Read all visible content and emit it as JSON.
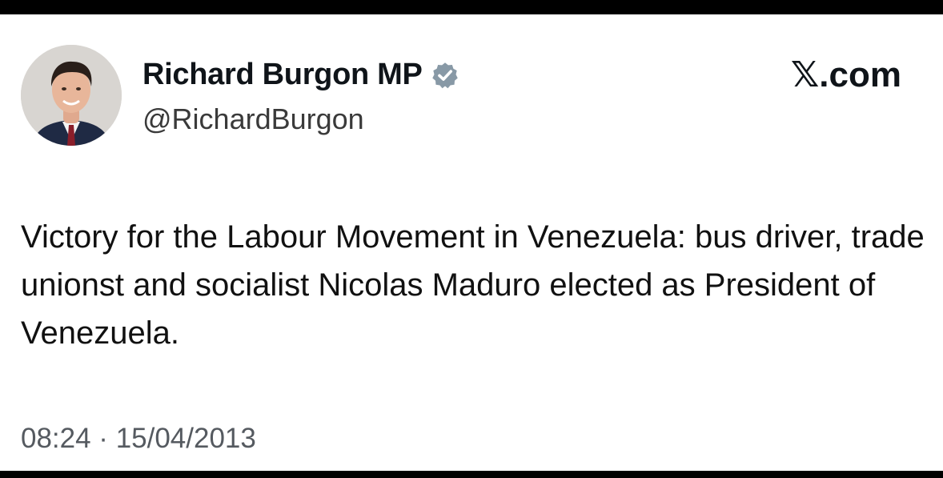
{
  "author": {
    "display_name": "Richard Burgon MP",
    "handle": "@RichardBurgon",
    "verified_icon": "verified-badge-icon",
    "verified_color": "#8899a6"
  },
  "brand": {
    "label": "𝕏.com"
  },
  "tweet": {
    "text": "Victory for the Labour Movement in Venezuela: bus driver, trade unionst and socialist Nicolas Maduro elected as President of Venezuela.",
    "timestamp": "08:24 · 15/04/2013"
  }
}
